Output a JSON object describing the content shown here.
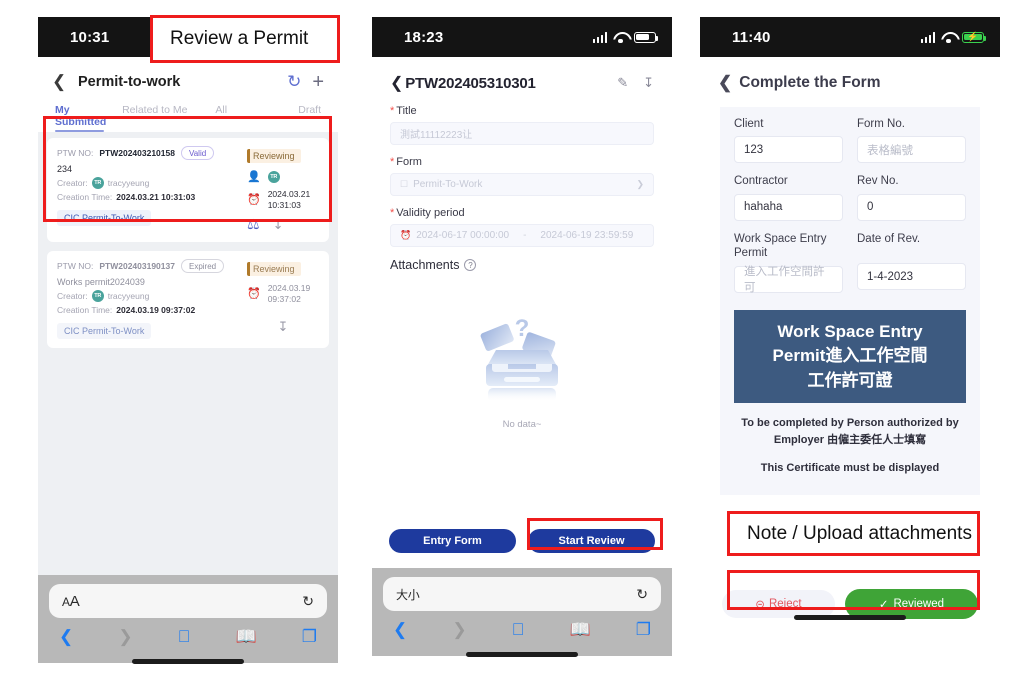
{
  "annotations": [
    {
      "id": "review-a-permit",
      "text": "Review a Permit"
    },
    {
      "id": "note-upload-attachments",
      "text": "Note / Upload attachments"
    }
  ],
  "colors": {
    "accent_blue": "#5f6fd0",
    "button_blue": "#1e3a9e",
    "banner_blue": "#3d5a80",
    "green": "#3fa437",
    "reject_red": "#e2575f",
    "annotation_red": "#ee1c1c",
    "badge_amber": "#b07a2a"
  },
  "phone1": {
    "status": {
      "time": "10:31"
    },
    "nav": {
      "back_icon": "chevron-left-icon",
      "title": "Permit-to-work",
      "refresh_icon": "refresh-icon",
      "add_icon": "plus-icon"
    },
    "tabs": [
      {
        "label": "My Submitted",
        "active": true
      },
      {
        "label": "Related to Me",
        "active": false
      },
      {
        "label": "All",
        "active": false
      },
      {
        "label": "Draft",
        "active": false
      }
    ],
    "cards": [
      {
        "ptw_label": "PTW NO:",
        "ptw_no": "PTW202403210158",
        "status_pill": "Valid",
        "description": "234",
        "creator_label": "Creator:",
        "creator_initials": "TR",
        "creator_name": "tracyyeung",
        "creation_label": "Creation Time:",
        "creation_time": "2024.03.21 10:31:03",
        "tag": "CIC Permit-To-Work",
        "review_badge": "Reviewing",
        "reviewer_initials": "TR",
        "timestamp_date": "2024.03.21",
        "timestamp_time": "10:31:03",
        "has_stamp": true,
        "has_download": true
      },
      {
        "ptw_label": "PTW NO:",
        "ptw_no": "PTW202403190137",
        "status_pill": "Expired",
        "description": "Works permit2024039",
        "creator_label": "Creator:",
        "creator_initials": "TR",
        "creator_name": "tracyyeung",
        "creation_label": "Creation Time:",
        "creation_time": "2024.03.19 09:37:02",
        "tag": "CIC Permit-To-Work",
        "review_badge": "Reviewing",
        "reviewer_initials": "",
        "timestamp_date": "2024.03.19",
        "timestamp_time": "09:37:02",
        "has_stamp": false,
        "has_download": true
      }
    ],
    "safari": {
      "aa_label": "AA",
      "reload_icon": "reload-icon",
      "back_icon": "chevron-left-icon",
      "forward_icon": "chevron-right-icon",
      "share_icon": "share-icon",
      "bookmarks_icon": "book-icon",
      "tabs_icon": "tabs-icon"
    }
  },
  "phone2": {
    "status": {
      "time": "18:23"
    },
    "nav": {
      "back_icon": "chevron-left-icon",
      "title": "PTW202405310301",
      "edit_icon": "pencil-icon",
      "download_icon": "download-icon"
    },
    "fields": [
      {
        "label": "Title",
        "required": true,
        "value": "測試11112223让",
        "type": "text"
      },
      {
        "label": "Form",
        "required": true,
        "value": "Permit-To-Work",
        "type": "select"
      },
      {
        "label": "Validity period",
        "required": true,
        "value_start": "2024-06-17 00:00:00",
        "value_sep": "-",
        "value_end": "2024-06-19 23:59:59",
        "type": "daterange"
      }
    ],
    "attachments": {
      "label": "Attachments",
      "help_icon": "question-circle-icon",
      "empty_text": "No data~"
    },
    "buttons": [
      {
        "label": "Entry Form",
        "style": "primary"
      },
      {
        "label": "Start Review",
        "style": "primary",
        "highlighted": true
      }
    ],
    "safari": {
      "aa_label": "大小",
      "reload_icon": "reload-icon",
      "back_icon": "chevron-left-icon",
      "forward_icon": "chevron-right-icon",
      "share_icon": "share-icon",
      "bookmarks_icon": "book-icon",
      "tabs_icon": "tabs-icon"
    }
  },
  "phone3": {
    "status": {
      "time": "11:40",
      "battery": "charging"
    },
    "nav": {
      "back_icon": "chevron-left-icon",
      "title": "Complete the Form"
    },
    "form_rows": [
      {
        "left": {
          "label": "Client",
          "value": "123",
          "placeholder": false
        },
        "right": {
          "label": "Form No.",
          "value": "表格編號",
          "placeholder": true
        }
      },
      {
        "left": {
          "label": "Contractor",
          "value": "hahaha",
          "placeholder": false
        },
        "right": {
          "label": "Rev No.",
          "value": "0",
          "placeholder": false
        }
      },
      {
        "left": {
          "label": "Work Space Entry Permit",
          "value": "進入工作空間許可",
          "placeholder": true
        },
        "right": {
          "label": "Date of Rev.",
          "value": "1-4-2023",
          "placeholder": false
        }
      }
    ],
    "banner": {
      "line1": "Work Space Entry",
      "line2": "Permit進入工作空間",
      "line3": "工作許可證"
    },
    "paragraphs": [
      "To be completed by Person authorized by Employer 由僱主委任人士填寫",
      "This Certificate must be displayed"
    ],
    "buttons": [
      {
        "label": "Reject",
        "icon": "cross-circle-icon",
        "style": "secondary"
      },
      {
        "label": "Reviewed",
        "icon": "check-circle-icon",
        "style": "success"
      }
    ]
  }
}
